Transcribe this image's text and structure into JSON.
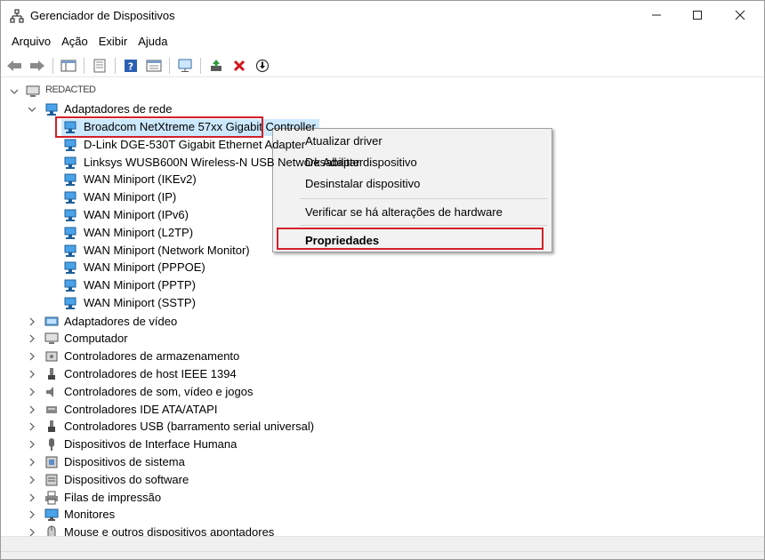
{
  "window": {
    "title": "Gerenciador de Dispositivos"
  },
  "menu": [
    "Arquivo",
    "Ação",
    "Exibir",
    "Ajuda"
  ],
  "tree": {
    "root": "REDACTED",
    "category_open": "Adaptadores de rede",
    "network_adapters": [
      "Broadcom NetXtreme 57xx Gigabit Controller",
      "D-Link DGE-530T Gigabit Ethernet Adapter",
      "Linksys WUSB600N Wireless-N USB Network Adapter",
      "WAN Miniport (IKEv2)",
      "WAN Miniport (IP)",
      "WAN Miniport (IPv6)",
      "WAN Miniport (L2TP)",
      "WAN Miniport (Network Monitor)",
      "WAN Miniport (PPPOE)",
      "WAN Miniport (PPTP)",
      "WAN Miniport (SSTP)"
    ],
    "categories": [
      "Adaptadores de vídeo",
      "Computador",
      "Controladores de armazenamento",
      "Controladores de host IEEE 1394",
      "Controladores de som, vídeo e jogos",
      "Controladores IDE ATA/ATAPI",
      "Controladores USB (barramento serial universal)",
      "Dispositivos de Interface Humana",
      "Dispositivos de sistema",
      "Dispositivos do software",
      "Filas de impressão",
      "Monitores",
      "Mouse e outros dispositivos apontadores"
    ]
  },
  "context_menu": {
    "items": [
      "Atualizar driver",
      "Desabilitar dispositivo",
      "Desinstalar dispositivo"
    ],
    "scan": "Verificar se há alterações de hardware",
    "properties": "Propriedades"
  },
  "colors": {
    "highlight": "#d3202a",
    "selection": "#cce8ff",
    "netcard": "#3a8fd6"
  }
}
